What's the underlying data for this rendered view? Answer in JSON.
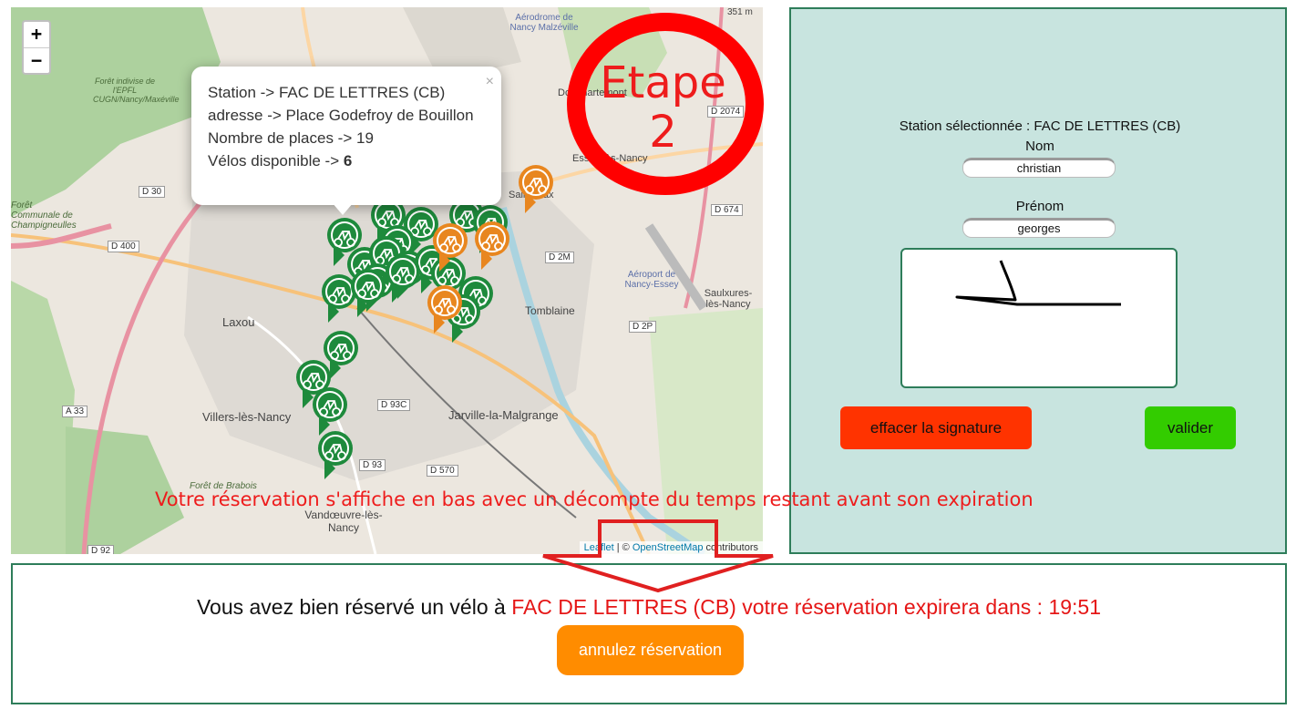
{
  "map": {
    "zoom_in": "+",
    "zoom_out": "−",
    "popup": {
      "close": "×",
      "line1": "Station -> FAC DE LETTRES (CB)",
      "line2": "adresse -> Place Godefroy de Bouillon",
      "line3": "Nombre de places -> 19",
      "line4_prefix": "Vélos disponible -> ",
      "line4_value": "6"
    },
    "attribution": {
      "leaflet": "Leaflet",
      "sep": " | © ",
      "osm": "OpenStreetMap",
      "suffix": " contributors"
    },
    "places": [
      {
        "name": "Laxou"
      },
      {
        "name": "Villers-lès-Nancy"
      },
      {
        "name": "Jarville-la-Malgrange"
      },
      {
        "name": "Tomblaine"
      },
      {
        "name": "Vandœuvre-lès-Nancy"
      },
      {
        "name": "Saulxures-lès-Nancy"
      },
      {
        "name": "Aéroport de Nancy-Essey"
      },
      {
        "name": "Aérodrome de Nancy Malzéville"
      },
      {
        "name": "Dommartemont"
      },
      {
        "name": "Essey-lès-Nancy"
      },
      {
        "name": "Saint-Max"
      },
      {
        "name": "Forêt indivise de l'EPFL CUGN/Nancy/Maxéville"
      },
      {
        "name": "Forêt Communale de Champigneulles"
      },
      {
        "name": "Forêt de Brabois"
      },
      {
        "name": "351 m"
      }
    ],
    "roads": [
      "D 30",
      "D 400",
      "D 2M",
      "D 674",
      "D 2P",
      "D 93C",
      "D 93",
      "D 570",
      "A 33",
      "D 92",
      "D 2074"
    ],
    "colors": {
      "station_green": "#1e8a3c",
      "station_orange": "#e8861f"
    }
  },
  "etape": {
    "line1": "Etape",
    "line2": "2",
    "color": "#ff0000"
  },
  "panel": {
    "station_label": "Station sélectionnée : FAC DE LETTRES (CB)",
    "nom_label": "Nom",
    "nom_value": "christian",
    "prenom_label": "Prénom",
    "prenom_value": "georges",
    "clear_button": "effacer la signature",
    "validate_button": "valider"
  },
  "annotation": "Votre réservation s'affiche en bas avec un décompte du temps restant avant son expiration",
  "reservation": {
    "prefix": "Vous avez bien réservé un vélo à ",
    "station": "FAC DE LETTRES (CB)",
    "middle": " votre réservation expirera dans : ",
    "timer": "19:51",
    "cancel_button": "annulez réservation"
  }
}
